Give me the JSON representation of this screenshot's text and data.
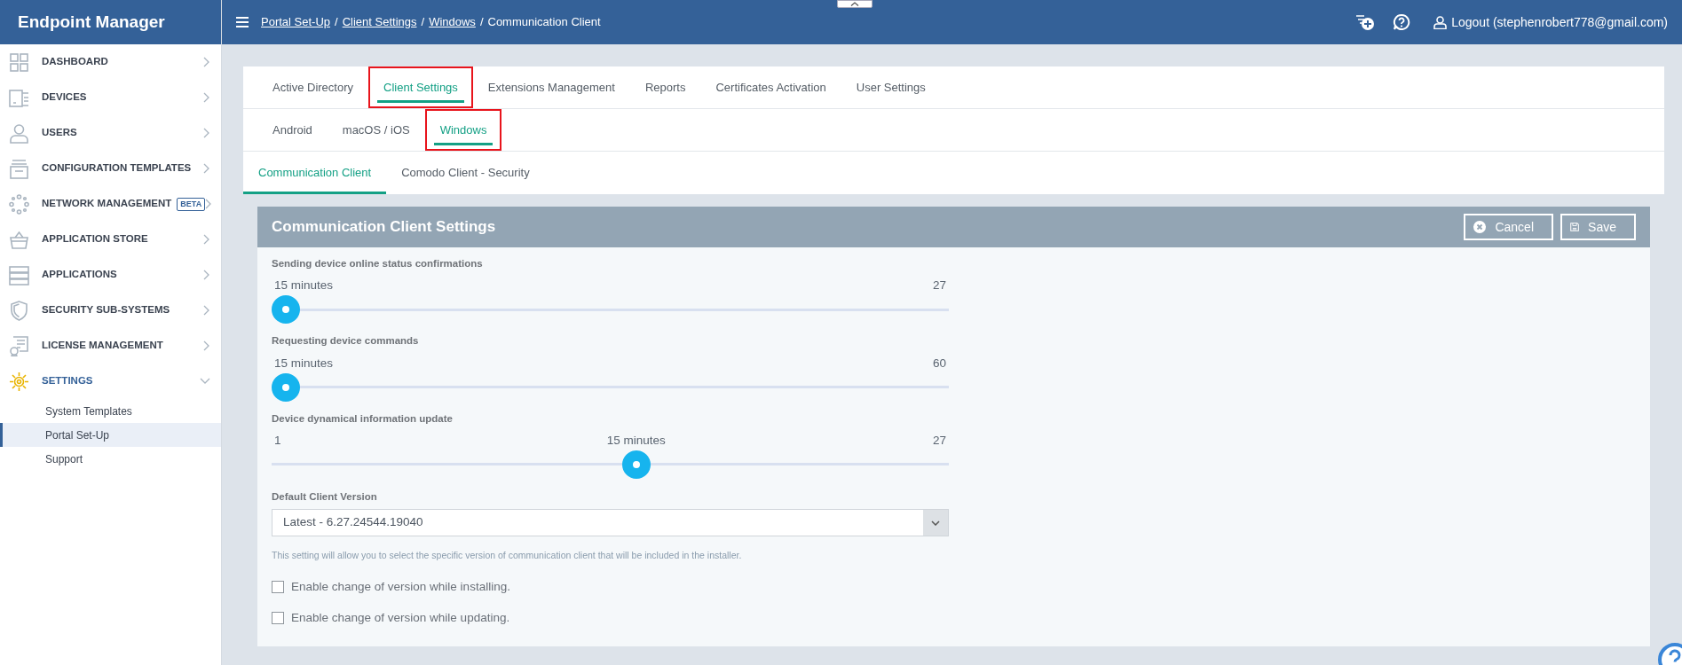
{
  "app": {
    "title": "Endpoint Manager"
  },
  "sidebar": {
    "items": [
      {
        "kind": "dashboard",
        "label": "DASHBOARD",
        "expanded": false,
        "selected": false
      },
      {
        "kind": "devices",
        "label": "DEVICES",
        "expanded": false,
        "selected": false
      },
      {
        "kind": "users",
        "label": "USERS",
        "expanded": false,
        "selected": false
      },
      {
        "kind": "templates",
        "label": "CONFIGURATION TEMPLATES",
        "expanded": false,
        "selected": false
      },
      {
        "kind": "network",
        "label": "NETWORK MANAGEMENT",
        "badge": "BETA",
        "expanded": false,
        "selected": false
      },
      {
        "kind": "store",
        "label": "APPLICATION STORE",
        "expanded": false,
        "selected": false
      },
      {
        "kind": "applications",
        "label": "APPLICATIONS",
        "expanded": false,
        "selected": false
      },
      {
        "kind": "security",
        "label": "SECURITY SUB-SYSTEMS",
        "expanded": false,
        "selected": false
      },
      {
        "kind": "license",
        "label": "LICENSE MANAGEMENT",
        "expanded": false,
        "selected": false
      },
      {
        "kind": "settings",
        "label": "SETTINGS",
        "expanded": true,
        "selected": true,
        "children": [
          {
            "label": "System Templates",
            "selected": false
          },
          {
            "label": "Portal Set-Up",
            "selected": true
          },
          {
            "label": "Support",
            "selected": false
          }
        ]
      }
    ]
  },
  "topbar": {
    "breadcrumbs": [
      {
        "label": "Portal Set-Up",
        "link": true
      },
      {
        "label": "Client Settings",
        "link": true
      },
      {
        "label": "Windows",
        "link": true
      },
      {
        "label": "Communication Client",
        "link": false
      }
    ],
    "separator": "/",
    "user": "Logout (stephenrobert778@gmail.com)"
  },
  "tabs": [
    {
      "label": "Active Directory",
      "selected": false,
      "highlighted": false
    },
    {
      "label": "Client Settings",
      "selected": true,
      "highlighted": true
    },
    {
      "label": "Extensions Management",
      "selected": false,
      "highlighted": false
    },
    {
      "label": "Reports",
      "selected": false,
      "highlighted": false
    },
    {
      "label": "Certificates Activation",
      "selected": false,
      "highlighted": false
    },
    {
      "label": "User Settings",
      "selected": false,
      "highlighted": false
    }
  ],
  "os_tabs": [
    {
      "label": "Android",
      "selected": false,
      "highlighted": false
    },
    {
      "label": "macOS / iOS",
      "selected": false,
      "highlighted": false
    },
    {
      "label": "Windows",
      "selected": true,
      "highlighted": true
    }
  ],
  "client_tabs": [
    {
      "label": "Communication Client",
      "selected": true
    },
    {
      "label": "Comodo Client - Security",
      "selected": false
    }
  ],
  "panel": {
    "title": "Communication Client Settings",
    "buttons": [
      {
        "kind": "cancel",
        "label": "Cancel"
      },
      {
        "kind": "save",
        "label": "Save"
      }
    ],
    "sliders": [
      {
        "label": "Sending device online status confirmations",
        "value": "15 minutes",
        "max": "27",
        "level": 0
      },
      {
        "label": "Requesting device commands",
        "value": "15 minutes",
        "max": "60",
        "level": 0
      },
      {
        "label": "Device dynamical information update",
        "min": "1",
        "value": "15 minutes",
        "max": "27",
        "level": 0.54
      }
    ],
    "version": {
      "label": "Default Client Version",
      "value": "Latest - 6.27.24544.19040",
      "hint": "This setting will allow you to select the specific version of communication client that will be included in the installer."
    },
    "checkboxes": [
      {
        "label": "Enable change of version while installing.",
        "checked": false
      },
      {
        "label": "Enable change of version while updating.",
        "checked": false
      }
    ]
  }
}
